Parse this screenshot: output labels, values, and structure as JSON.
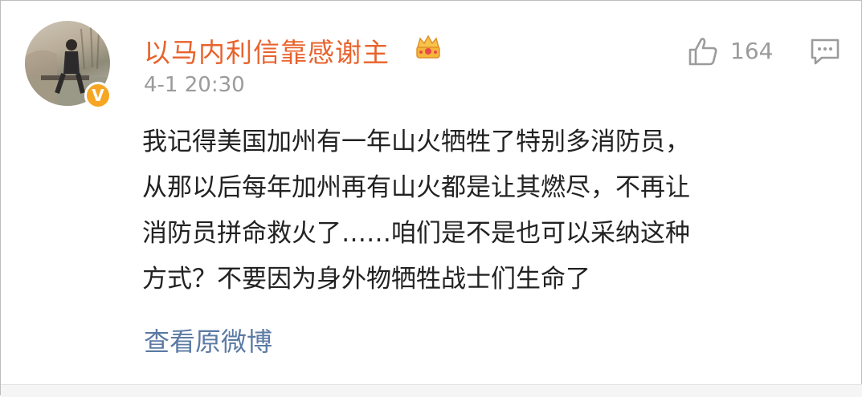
{
  "comment": {
    "username": "以马内利信靠感谢主",
    "timestamp": "4-1 20:30",
    "likes": "164",
    "lines": [
      "我记得美国加州有一年山火牺牲了特别多消防员，",
      "从那以后每年加州再有山火都是让其燃尽，不再让",
      "消防员拼命救火了……咱们是不是也可以采纳这种",
      "方式？不要因为身外物牺牲战士们生命了"
    ],
    "view_original": "查看原微博"
  },
  "icons": {
    "verified_badge": "verified-v-icon",
    "member_badge": "crown-icon",
    "like": "thumbs-up-icon",
    "reply": "comment-icon"
  },
  "colors": {
    "username": "#e8632c",
    "link": "#5b7aa3",
    "meta": "#9b9b9b",
    "verified": "#f6a623"
  }
}
